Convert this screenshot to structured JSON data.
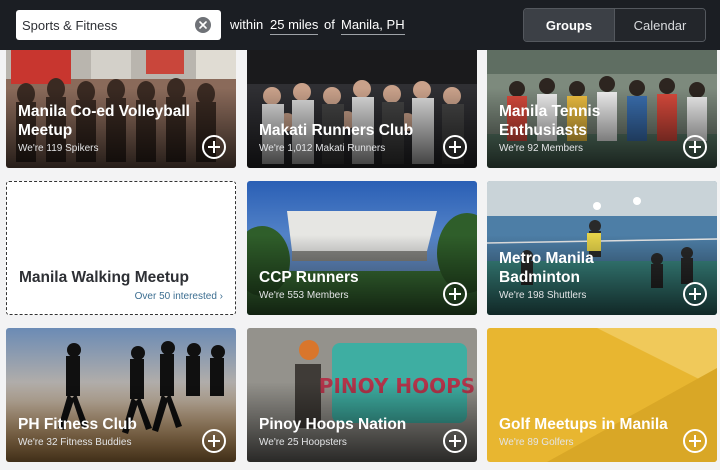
{
  "search": {
    "value": "Sports & Fitness"
  },
  "filters": {
    "within_label": "within",
    "distance": "25 miles",
    "of_label": "of",
    "location": "Manila, PH"
  },
  "view_toggle": {
    "groups": "Groups",
    "calendar": "Calendar",
    "selected": "Groups"
  },
  "groups": [
    {
      "title": "Manila Co-ed Volleyball Meetup",
      "subtitle": "We're 119 Spikers"
    },
    {
      "title": "Makati Runners Club",
      "subtitle": "We're 1,012 Makati Runners"
    },
    {
      "title": "Manila Tennis Enthusiasts",
      "subtitle": "We're 92 Members"
    },
    {
      "title": "Manila Walking Meetup",
      "subtitle": "Over 50 interested ›"
    },
    {
      "title": "CCP Runners",
      "subtitle": "We're 553 Members"
    },
    {
      "title": "Metro Manila Badminton",
      "subtitle": "We're 198 Shuttlers"
    },
    {
      "title": "PH Fitness Club",
      "subtitle": "We're 32 Fitness Buddies"
    },
    {
      "title": "Pinoy Hoops Nation",
      "subtitle": "We're 25 Hoopsters"
    },
    {
      "title": "Golf Meetups in Manila",
      "subtitle": "We're 89 Golfers"
    }
  ],
  "photo_graffiti_text": "PINOY HOOPS",
  "colors": {
    "topbar": "#1b1e23",
    "page_bg": "#f3f3f4",
    "golf_card": "#e8b630",
    "link": "#3c6e91"
  },
  "icons": [
    "clear-icon",
    "join-plus-icon"
  ]
}
